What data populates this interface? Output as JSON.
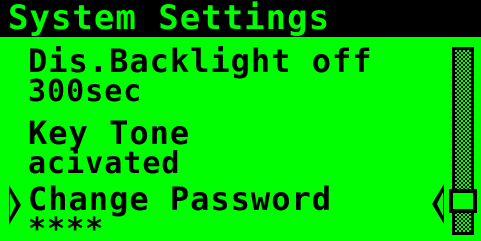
{
  "header": {
    "title": "System Settings"
  },
  "settings": {
    "items": [
      {
        "label": "Dis.Backlight off",
        "value": "300sec"
      },
      {
        "label": "Key Tone",
        "value": "acivated"
      },
      {
        "label": "Change Password",
        "value": "****"
      }
    ],
    "selected_index": 2
  },
  "scrollbar": {
    "position_fraction": 0.85
  },
  "colors": {
    "background": "#00ff00",
    "foreground": "#000000"
  },
  "icons": {
    "selection": "selection-arrow-icon",
    "scroll": "scroll-position-arrow-icon"
  }
}
